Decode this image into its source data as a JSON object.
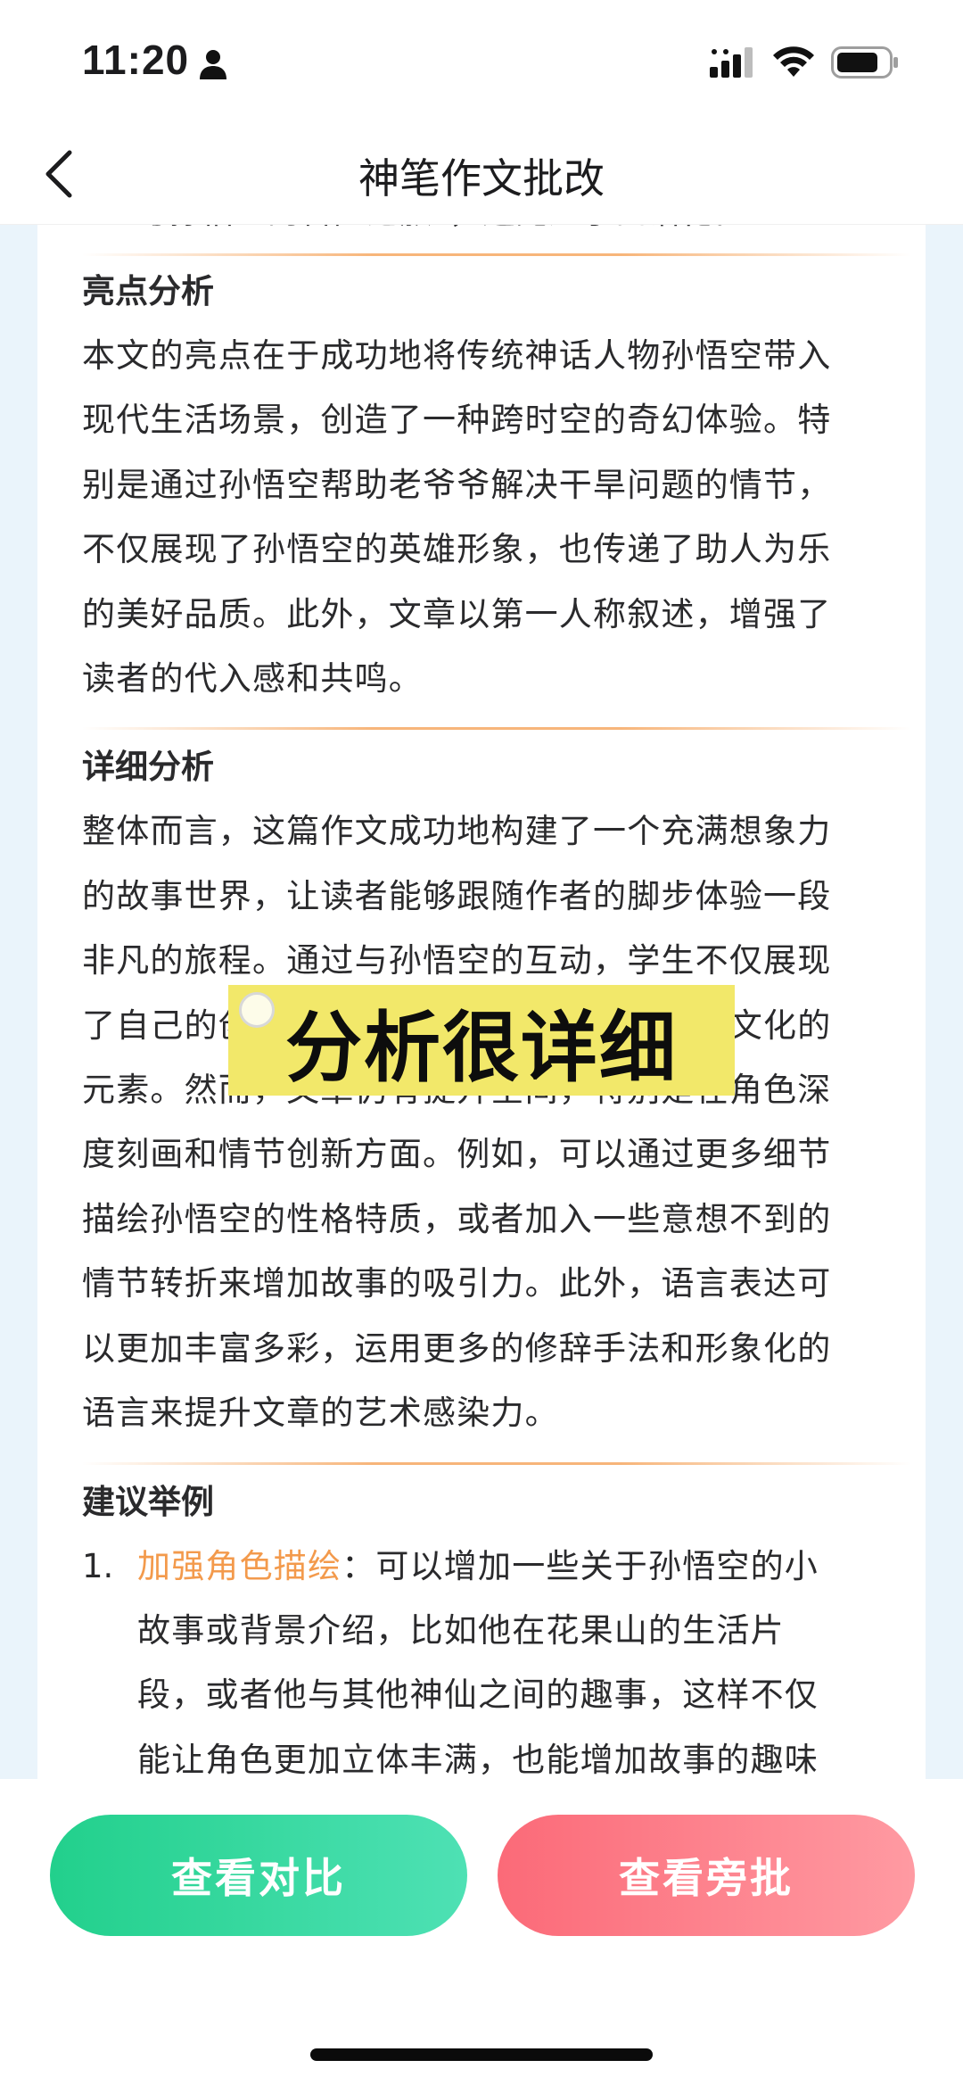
{
  "status_bar": {
    "time": "11:20"
  },
  "nav": {
    "title": "神笔作文批改"
  },
  "content": {
    "cut_line": "与孙悟空的冒险之旅”，避免过于口语化。",
    "sections": [
      {
        "title": "亮点分析",
        "lines": [
          "本文的亮点在于成功地将传统神话人物孙悟空带入",
          "现代生活场景，创造了一种跨时空的奇幻体验。特",
          "别是通过孙悟空帮助老爷爷解决干旱问题的情节，",
          "不仅展现了孙悟空的英雄形象，也传递了助人为乐",
          "的美好品质。此外，文章以第一人称叙述，增强了",
          "读者的代入感和共鸣。"
        ]
      },
      {
        "title": "详细分析",
        "lines": [
          "整体而言，这篇作文成功地构建了一个充满想象力",
          "的故事世界，让读者能够跟随作者的脚步体验一段",
          "非凡的旅程。通过与孙悟空的互动，学生不仅展现",
          "了自己的创造力，还巧妙地融入了中国传统文化的",
          "元素。然而，文章仍有提升空间，特别是在角色深",
          "度刻画和情节创新方面。例如，可以通过更多细节",
          "描绘孙悟空的性格特质，或者加入一些意想不到的",
          "情节转折来增加故事的吸引力。此外，语言表达可",
          "以更加丰富多彩，运用更多的修辞手法和形象化的",
          "语言来提升文章的艺术感染力。"
        ]
      },
      {
        "title": "建议举例",
        "items": [
          {
            "num": "1.",
            "highlight": "加强角色描绘",
            "first_rest": "：可以增加一些关于孙悟空的小",
            "lines": [
              "故事或背景介绍，比如他在花果山的生活片",
              "段，或者他与其他神仙之间的趣事，这样不仅",
              "能让角色更加立体丰满，也能增加故事的趣味"
            ]
          }
        ]
      }
    ]
  },
  "overlay": {
    "caption": "分析很详细"
  },
  "buttons": {
    "compare": "查看对比",
    "annotate": "查看旁批"
  },
  "colors": {
    "accent_orange": "#f39a4c",
    "green_button": "#2bd597",
    "red_button": "#fc7681",
    "caption_yellow": "#f2e86a"
  }
}
